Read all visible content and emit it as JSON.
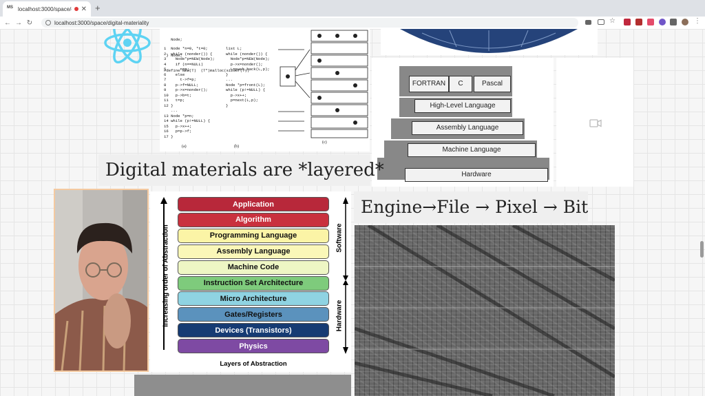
{
  "browser": {
    "tab": {
      "favicon": "MS",
      "title": "localhost:3000/space/digi"
    },
    "url": "localhost:3000/space/digital-materiality"
  },
  "canvas": {
    "heading_layered": "Digital materials are *layered*",
    "heading_engine": "Engine→File → Pixel → Bit",
    "code": {
      "top": [
        "   Node; ",
        " } Node;",
        "#define NEW(T)  (T*)malloc(sizeof(T))"
      ],
      "left": [
        "1  Node *n=0, *t=0;",
        "",
        "2  while (nonder()) {",
        "3    Node*p=NEW(Node);",
        "4    if (n==NULL)",
        "5      n=p;",
        "6    else",
        "7      t->f=p;",
        "8    p->f=NULL;",
        "9    p->x=nonder();",
        "10   p->b=t;",
        "11   t=p;",
        "12 }",
        "   ...",
        "13 Node *p=n;",
        "14 while (p!=NULL) {",
        "15   p->x++;",
        "16   p=p->f;",
        "17 }"
      ],
      "right": [
        "list L;",
        "",
        "while (nonder()) {",
        "  Node*p=NEW(Node);",
        "",
        "",
        "",
        "",
        "",
        "  p->x=nonder();",
        "",
        "  L=push_back(L,p);",
        "}",
        "...",
        "Node *p=front(L);",
        "while (p!=NULL) {",
        "  p->x++;",
        "  p=next(L,p);",
        "}"
      ],
      "caption_a": "(a)",
      "caption_b": "(b)",
      "caption_c": "(c)"
    },
    "stack": {
      "top": [
        "FORTRAN",
        "C",
        "Pascal"
      ],
      "levels": [
        "High-Level Language",
        "Assembly Language",
        "Machine Language",
        "Hardware"
      ]
    },
    "abstraction": {
      "left_axis": "Increasing order of Abstraction",
      "software": "Software",
      "hardware": "Hardware",
      "caption": "Layers of Abstraction",
      "rows": [
        {
          "label": "Application",
          "bg": "#b8283a",
          "fg": "#ffffff"
        },
        {
          "label": "Algorithm",
          "bg": "#c9313e",
          "fg": "#ffffff"
        },
        {
          "label": "Programming Language",
          "bg": "#fbf4a6",
          "fg": "#111111"
        },
        {
          "label": "Assembly Language",
          "bg": "#faf7b8",
          "fg": "#111111"
        },
        {
          "label": "Machine Code",
          "bg": "#eef6c4",
          "fg": "#111111"
        },
        {
          "label": "Instruction Set Architecture",
          "bg": "#7ecb7c",
          "fg": "#111111"
        },
        {
          "label": "Micro Architecture",
          "bg": "#8fd3e2",
          "fg": "#111111"
        },
        {
          "label": "Gates/Registers",
          "bg": "#5b92bd",
          "fg": "#111111"
        },
        {
          "label": "Devices (Transistors)",
          "bg": "#163b73",
          "fg": "#ffffff"
        },
        {
          "label": "Physics",
          "bg": "#7e4aa3",
          "fg": "#ffffff"
        }
      ]
    }
  }
}
